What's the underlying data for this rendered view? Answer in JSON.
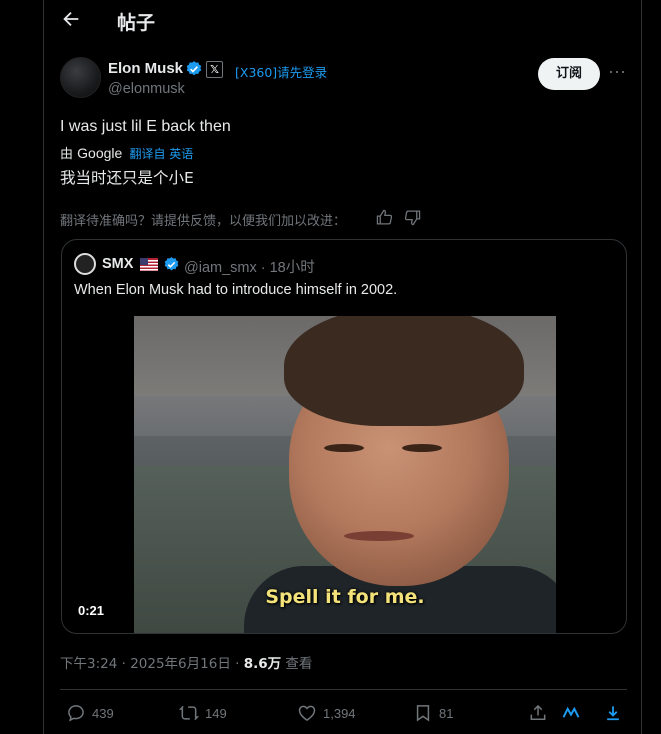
{
  "header": {
    "title": "帖子"
  },
  "author": {
    "name": "Elon Musk",
    "handle": "@elonmusk",
    "login_link": "[X360]请先登录",
    "subscribe_label": "订阅"
  },
  "tweet": {
    "text": "I was just lil E back then",
    "translate_by": "由",
    "translate_google": "Google",
    "translate_from": "翻译自 英语",
    "translated_text": "我当时还只是个小E",
    "feedback_prompt": "翻译待准确吗？请提供反馈，以便我们加以改进："
  },
  "quote": {
    "name": "SMX",
    "handle_time": "@iam_smx · 18小时",
    "text": "When Elon Musk had to introduce himself in 2002.",
    "video_caption": "Spell it for me.",
    "video_duration": "0:21"
  },
  "meta": {
    "time": "下午3:24 · 2025年6月16日 · ",
    "views": "8.6万",
    "views_label": " 查看"
  },
  "actions": {
    "replies": "439",
    "reposts": "149",
    "likes": "1,394",
    "bookmarks": "81"
  },
  "colors": {
    "accent": "#1d9bf0",
    "background": "#000000",
    "text_primary": "#e7e9ea",
    "text_secondary": "#71767b",
    "border": "#2f3336",
    "caption": "#f3e27a"
  },
  "icons": [
    "back-arrow-icon",
    "verified-icon",
    "x-logo-icon",
    "more-icon",
    "thumbs-up-icon",
    "thumbs-down-icon",
    "us-flag-icon",
    "reply-icon",
    "repost-icon",
    "like-icon",
    "bookmark-icon",
    "share-icon",
    "grok-icon",
    "download-icon"
  ]
}
